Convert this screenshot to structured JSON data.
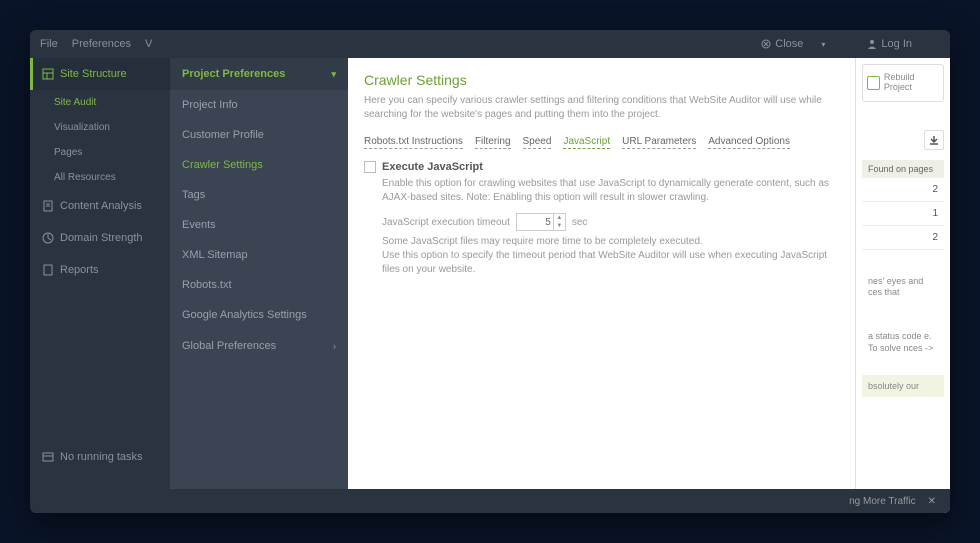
{
  "menubar": {
    "file": "File",
    "preferences": "Preferences",
    "view": "V",
    "close": "Close",
    "login": "Log In"
  },
  "leftnav": {
    "site_structure": "Site Structure",
    "site_audit": "Site Audit",
    "visualization": "Visualization",
    "pages": "Pages",
    "all_resources": "All Resources",
    "content_analysis": "Content Analysis",
    "domain_strength": "Domain Strength",
    "reports": "Reports",
    "no_tasks": "No running tasks"
  },
  "prefpanel": {
    "header": "Project Preferences",
    "items": [
      "Project Info",
      "Customer Profile",
      "Crawler Settings",
      "Tags",
      "Events",
      "XML Sitemap",
      "Robots.txt",
      "Google Analytics Settings"
    ],
    "footer": "Global Preferences"
  },
  "content": {
    "title": "Crawler Settings",
    "desc": "Here you can specify various crawler settings and filtering conditions that WebSite Auditor will use while searching for the website's pages and putting them into the project.",
    "tabs": [
      "Robots.txt Instructions",
      "Filtering",
      "Speed",
      "JavaScript",
      "URL Parameters",
      "Advanced Options"
    ],
    "active_tab": "JavaScript",
    "checkbox_label": "Execute JavaScript",
    "help1": "Enable this option for crawling websites that use JavaScript to dynamically generate content, such as AJAX-based sites. Note: Enabling this option will result in slower crawling.",
    "timeout_label": "JavaScript execution timeout",
    "timeout_value": "5",
    "timeout_unit": "sec",
    "help2": "Some JavaScript files may require more time to be completely executed.\nUse this option to specify the timeout period that WebSite Auditor will use when executing JavaScript files on your website."
  },
  "right": {
    "rebuild": "Rebuild Project",
    "col_header": "Found on pages",
    "vals": [
      "2",
      "1",
      "2"
    ],
    "snip1": "nes' eyes and ces that",
    "snip2": "a status code e. To solve nces ->",
    "snip3": "bsolutely our",
    "footer": "ng More Traffic"
  }
}
